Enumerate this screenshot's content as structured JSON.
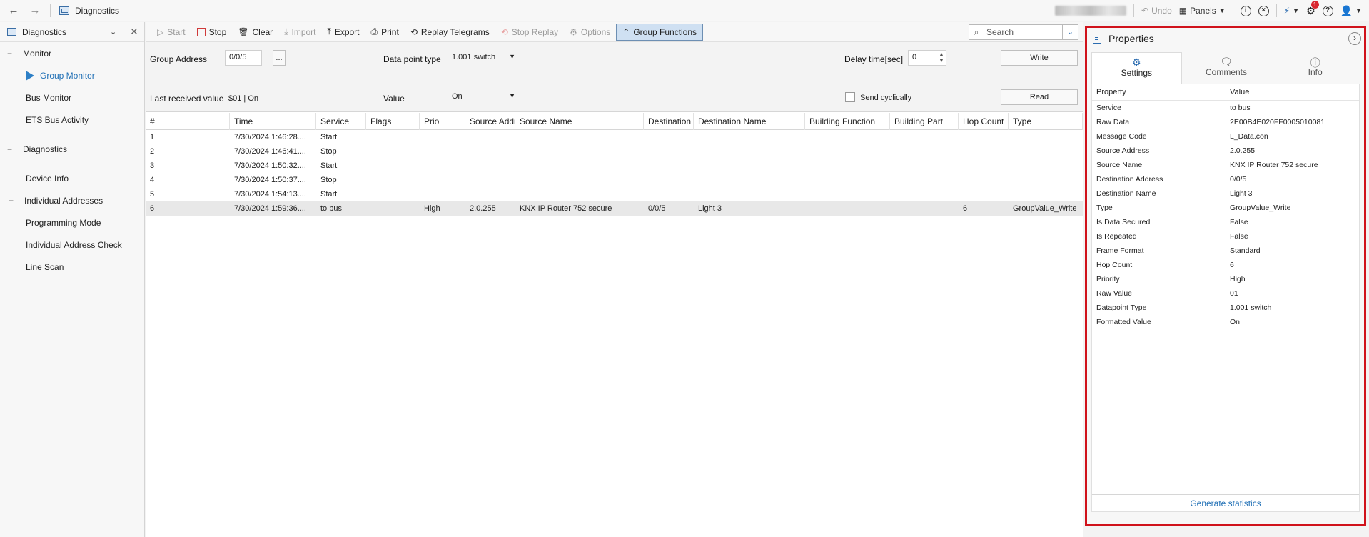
{
  "titlebar": {
    "title": "Diagnostics",
    "undo": "Undo",
    "panels": "Panels",
    "notification_count": "1"
  },
  "sidebar": {
    "header": "Diagnostics",
    "sections": [
      {
        "label": "Monitor",
        "items": [
          "Group Monitor",
          "Bus Monitor",
          "ETS Bus Activity"
        ]
      },
      {
        "label": "Diagnostics",
        "items": [
          "Device Info",
          "Individual Addresses",
          "Programming Mode",
          "Individual Address Check",
          "Line Scan"
        ]
      }
    ]
  },
  "toolbar": {
    "start": "Start",
    "stop": "Stop",
    "clear": "Clear",
    "import": "Import",
    "export": "Export",
    "print": "Print",
    "replay": "Replay Telegrams",
    "stop_replay": "Stop Replay",
    "options": "Options",
    "group_functions": "Group Functions",
    "search_placeholder": "Search"
  },
  "controls": {
    "group_address_label": "Group Address",
    "group_address_value": "0/0/5",
    "browse": "...",
    "dpt_label": "Data point type",
    "dpt_value": "1.001 switch",
    "delay_label": "Delay time[sec]",
    "delay_value": "0",
    "write": "Write",
    "last_label": "Last received value",
    "last_value": "$01 | On",
    "value_label": "Value",
    "value_value": "On",
    "send_cyclically": "Send cyclically",
    "read": "Read"
  },
  "grid": {
    "columns": [
      "#",
      "Time",
      "Service",
      "Flags",
      "Prio",
      "Source Address",
      "Source Name",
      "Destination",
      "Destination Name",
      "Building Function",
      "Building Part",
      "Hop Count",
      "Type"
    ],
    "rows": [
      [
        "1",
        "7/30/2024 1:46:28....",
        "Start",
        "",
        "",
        "",
        "",
        "",
        "",
        "",
        "",
        "",
        ""
      ],
      [
        "2",
        "7/30/2024 1:46:41....",
        "Stop",
        "",
        "",
        "",
        "",
        "",
        "",
        "",
        "",
        "",
        ""
      ],
      [
        "3",
        "7/30/2024 1:50:32....",
        "Start",
        "",
        "",
        "",
        "",
        "",
        "",
        "",
        "",
        "",
        ""
      ],
      [
        "4",
        "7/30/2024 1:50:37....",
        "Stop",
        "",
        "",
        "",
        "",
        "",
        "",
        "",
        "",
        "",
        ""
      ],
      [
        "5",
        "7/30/2024 1:54:13....",
        "Start",
        "",
        "",
        "",
        "",
        "",
        "",
        "",
        "",
        "",
        ""
      ],
      [
        "6",
        "7/30/2024 1:59:36....",
        "to bus",
        "",
        "High",
        "2.0.255",
        "KNX IP Router 752 secure",
        "0/0/5",
        "Light 3",
        "",
        "",
        "6",
        "GroupValue_Write"
      ]
    ]
  },
  "properties": {
    "title": "Properties",
    "tabs": [
      "Settings",
      "Comments",
      "Info"
    ],
    "col_property": "Property",
    "col_value": "Value",
    "rows": [
      [
        "Service",
        "to bus"
      ],
      [
        "Raw Data",
        "2E00B4E020FF0005010081"
      ],
      [
        "Message Code",
        "L_Data.con"
      ],
      [
        "Source Address",
        "2.0.255"
      ],
      [
        "Source Name",
        "KNX IP Router 752 secure"
      ],
      [
        "Destination Address",
        "0/0/5"
      ],
      [
        "Destination Name",
        "Light 3"
      ],
      [
        "Type",
        "GroupValue_Write"
      ],
      [
        "Is Data Secured",
        "False"
      ],
      [
        "Is Repeated",
        "False"
      ],
      [
        "Frame Format",
        "Standard"
      ],
      [
        "Hop Count",
        "6"
      ],
      [
        "Priority",
        "High"
      ],
      [
        "Raw Value",
        "01"
      ],
      [
        "Datapoint Type",
        "1.001 switch"
      ],
      [
        "Formatted Value",
        "On"
      ]
    ],
    "generate": "Generate statistics"
  }
}
